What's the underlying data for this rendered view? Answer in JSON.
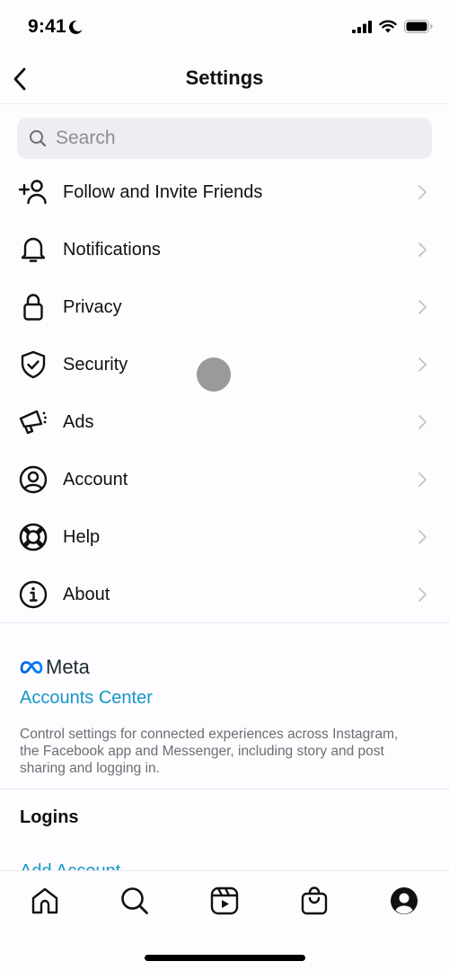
{
  "status_bar": {
    "time": "9:41",
    "focus_icon": "moon-icon",
    "signal_icon": "cellular-signal-icon",
    "wifi_icon": "wifi-icon",
    "battery_icon": "battery-icon"
  },
  "nav": {
    "title": "Settings",
    "back_icon": "chevron-left-icon"
  },
  "search": {
    "placeholder": "Search",
    "value": "",
    "icon": "search-icon"
  },
  "menu": {
    "items": [
      {
        "label": "Follow and Invite Friends",
        "icon": "add-person-icon"
      },
      {
        "label": "Notifications",
        "icon": "bell-icon"
      },
      {
        "label": "Privacy",
        "icon": "lock-icon"
      },
      {
        "label": "Security",
        "icon": "shield-check-icon"
      },
      {
        "label": "Ads",
        "icon": "megaphone-icon"
      },
      {
        "label": "Account",
        "icon": "person-circle-icon"
      },
      {
        "label": "Help",
        "icon": "lifebuoy-icon"
      },
      {
        "label": "About",
        "icon": "info-circle-icon"
      }
    ],
    "chevron_icon": "chevron-right-icon"
  },
  "meta": {
    "brand": "Meta",
    "brand_icon": "meta-infinity-icon",
    "brand_color": "#0668e1",
    "link": "Accounts Center",
    "link_color": "#1597c7",
    "description": "Control settings for connected experiences across Instagram, the Facebook app and Messenger, including story and post sharing and logging in."
  },
  "logins": {
    "title": "Logins",
    "add_account": "Add Account"
  },
  "tab_bar": {
    "tabs": [
      {
        "name": "home",
        "icon": "home-icon"
      },
      {
        "name": "search",
        "icon": "search-icon"
      },
      {
        "name": "reels",
        "icon": "reels-icon"
      },
      {
        "name": "shop",
        "icon": "shopping-bag-icon"
      },
      {
        "name": "profile",
        "icon": "profile-icon"
      }
    ]
  }
}
